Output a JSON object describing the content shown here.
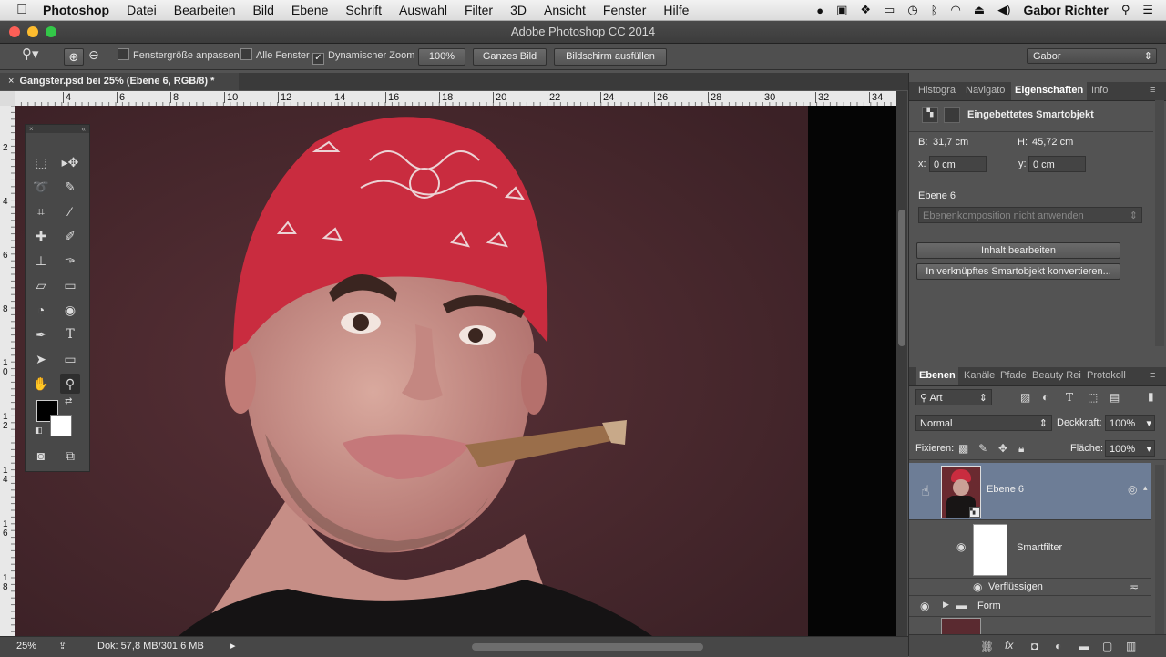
{
  "menubar": {
    "app": "Photoshop",
    "items": [
      "Datei",
      "Bearbeiten",
      "Bild",
      "Ebene",
      "Schrift",
      "Auswahl",
      "Filter",
      "3D",
      "Ansicht",
      "Fenster",
      "Hilfe"
    ],
    "user": "Gabor Richter"
  },
  "window": {
    "title": "Adobe Photoshop CC 2014"
  },
  "options": {
    "fit_window_label": "Fenstergröße anpassen",
    "all_windows_label": "Alle Fenster",
    "dynamic_zoom_label": "Dynamischer Zoom",
    "dynamic_zoom_checked": "✓",
    "zoom_100_label": "100%",
    "fit_screen_label": "Ganzes Bild",
    "fill_screen_label": "Bildschirm ausfüllen",
    "workspace": "Gabor"
  },
  "document": {
    "tab_label": "Gangster.psd bei 25% (Ebene 6, RGB/8) *",
    "ruler_top": [
      "4",
      "6",
      "8",
      "10",
      "12",
      "14",
      "16",
      "18",
      "20",
      "22",
      "24",
      "26",
      "28",
      "30",
      "32",
      "34"
    ],
    "ruler_left": [
      "2",
      "4",
      "6",
      "8",
      "1\n0",
      "1\n2",
      "1\n4",
      "1\n6",
      "1\n8"
    ]
  },
  "status": {
    "zoom": "25%",
    "doc_size": "Dok: 57,8 MB/301,6 MB"
  },
  "properties": {
    "tabs": [
      "Histogra",
      "Navigato",
      "Eigenschaften",
      "Info"
    ],
    "type_label": "Eingebettetes Smartobjekt",
    "b_label": "B:",
    "b_value": "31,7 cm",
    "h_label": "H:",
    "h_value": "45,72 cm",
    "x_label": "x:",
    "x_value": "0 cm",
    "y_label": "y:",
    "y_value": "0 cm",
    "layer_name": "Ebene 6",
    "comp_select": "Ebenenkomposition nicht anwenden",
    "edit_contents": "Inhalt bearbeiten",
    "convert_linked": "In verknüpftes Smartobjekt konvertieren..."
  },
  "layers": {
    "tabs": [
      "Ebenen",
      "Kanäle",
      "Pfade",
      "Beauty Rei",
      "Protokoll"
    ],
    "filter_kind": "Art",
    "blend_mode": "Normal",
    "opacity_label": "Deckkraft:",
    "opacity_value": "100%",
    "lock_label": "Fixieren:",
    "fill_label": "Fläche:",
    "fill_value": "100%",
    "items": [
      {
        "name": "Ebene 6"
      },
      {
        "name": "Smartfilter"
      },
      {
        "name": "Verflüssigen"
      },
      {
        "name": "Form"
      }
    ]
  },
  "colors": {
    "accent_selection": "#6d7d96",
    "bandana": "#c92c3f",
    "background": "#4a2a2f"
  }
}
